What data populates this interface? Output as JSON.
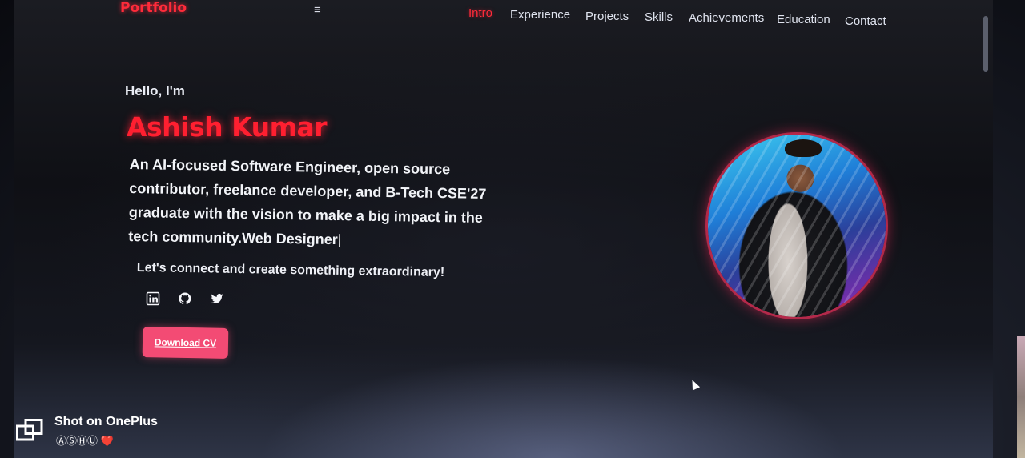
{
  "header": {
    "logo": "Portfolio",
    "menu_icon": "≡",
    "nav": [
      {
        "label": "Intro",
        "active": true
      },
      {
        "label": "Experience",
        "active": false
      },
      {
        "label": "Projects",
        "active": false
      },
      {
        "label": "Skills",
        "active": false
      },
      {
        "label": "Achievements",
        "active": false
      },
      {
        "label": "Education",
        "active": false
      },
      {
        "label": "Contact",
        "active": false
      }
    ]
  },
  "hero": {
    "greeting": "Hello, I'm",
    "name": "Ashish Kumar",
    "bio": "An AI-focused Software Engineer, open source contributor, freelance developer, and B-Tech CSE'27 graduate with the vision to make a big impact in the tech community.",
    "typed_text": "Web Designer",
    "typing_cursor": "|",
    "tagline": "Let's connect and create something extraordinary!",
    "socials": [
      {
        "icon": "linkedin-icon"
      },
      {
        "icon": "github-icon"
      },
      {
        "icon": "twitter-icon"
      }
    ],
    "cta_label": "Download CV"
  },
  "watermark": {
    "title": "Shot on OnePlus",
    "subtitle": "ⒶⓈⒽⓊ ❤️"
  },
  "colors": {
    "accent": "#ff2b3a",
    "button": "#f34b74",
    "background": "#0f1015"
  }
}
